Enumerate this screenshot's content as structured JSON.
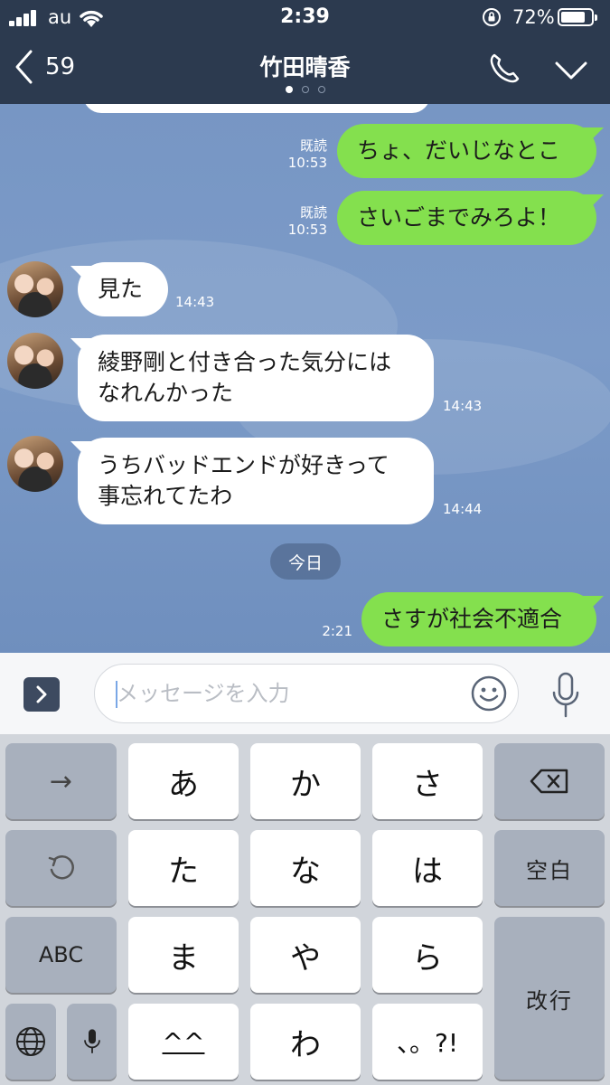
{
  "status_bar": {
    "carrier": "au",
    "time": "2:39",
    "battery_percent": "72%",
    "battery_level": 0.72
  },
  "header": {
    "back_count": "59",
    "title": "竹田晴香",
    "page_dots": 3,
    "active_dot": 0
  },
  "messages": [
    {
      "id": "m1",
      "side": "me",
      "text": "ちょ、だいじなとこ",
      "read": "既読",
      "time": "10:53"
    },
    {
      "id": "m2",
      "side": "me",
      "text": "さいごまでみろよ！",
      "read": "既読",
      "time": "10:53"
    },
    {
      "id": "m3",
      "side": "them",
      "text": "見た",
      "time": "14:43"
    },
    {
      "id": "m4",
      "side": "them",
      "lines": [
        "綾野剛と付き合った気分には",
        "なれんかった"
      ],
      "time": "14:43"
    },
    {
      "id": "m5",
      "side": "them",
      "lines": [
        "うちバッドエンドが好きって",
        "事忘れてたわ"
      ],
      "time": "14:44"
    },
    {
      "id": "m6",
      "side": "me",
      "text": "さすが社会不適合",
      "time": "2:21"
    }
  ],
  "date_separator": "今日",
  "input": {
    "placeholder": "メッセージを入力",
    "value": ""
  },
  "keyboard": {
    "row1": {
      "arrow": "→",
      "k1": "あ",
      "k2": "か",
      "k3": "さ"
    },
    "row2": {
      "k1": "た",
      "k2": "な",
      "k3": "は",
      "space": "空白"
    },
    "row3": {
      "abc": "ABC",
      "k1": "ま",
      "k2": "や",
      "k3": "ら",
      "enter": "改行"
    },
    "row4": {
      "k1": "^^",
      "k2": "わ",
      "k3": "、。?!"
    }
  },
  "colors": {
    "header_bg": "#2c3a4f",
    "my_bubble": "#84e04e",
    "their_bubble": "#ffffff",
    "chat_bg": "#7796c4",
    "keyboard_bg": "#d1d5db"
  }
}
